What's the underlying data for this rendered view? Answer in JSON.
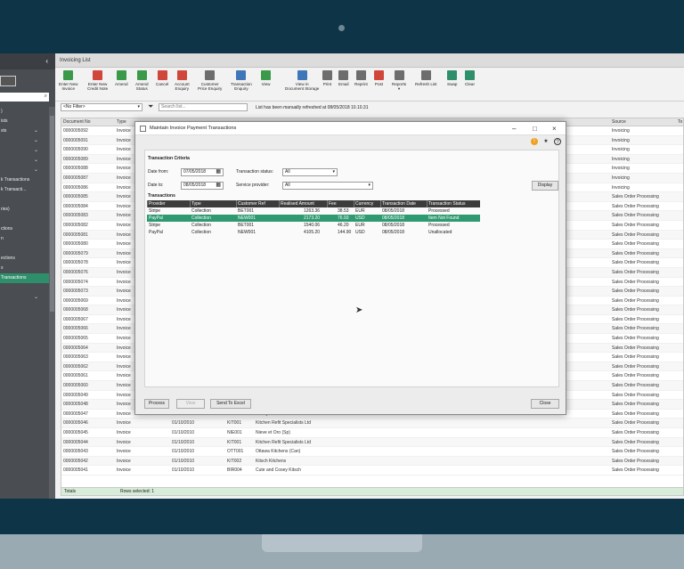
{
  "app": {
    "title": "Invoicing List"
  },
  "nav": {
    "collapse_icon": "‹",
    "items": [
      {
        "label": ")",
        "chev": ""
      },
      {
        "label": "ists",
        "chev": ""
      },
      {
        "label": "sts",
        "chev": "⌄"
      },
      {
        "label": "",
        "chev": "⌄"
      },
      {
        "label": "",
        "chev": "⌄"
      },
      {
        "label": "",
        "chev": "⌄"
      },
      {
        "label": "",
        "chev": "⌄"
      },
      {
        "label": "k Transactions",
        "chev": ""
      },
      {
        "label": "k Transacti...",
        "chev": ""
      },
      {
        "label": "",
        "chev": ""
      },
      {
        "label": "ries)",
        "chev": ""
      },
      {
        "label": "",
        "chev": ""
      },
      {
        "label": "ctions",
        "chev": ""
      },
      {
        "label": "n",
        "chev": ""
      },
      {
        "label": "",
        "chev": ""
      },
      {
        "label": "ections",
        "chev": ""
      },
      {
        "label": "s",
        "chev": ""
      },
      {
        "label": "Transactions",
        "chev": ""
      },
      {
        "label": "",
        "chev": ""
      },
      {
        "label": "",
        "chev": "⌄"
      }
    ]
  },
  "toolbar": {
    "buttons": [
      {
        "l1": "Enter New",
        "l2": "Invoice",
        "color": "green"
      },
      {
        "l1": "Enter New",
        "l2": "Credit Note",
        "color": "red"
      },
      {
        "l1": "Amend",
        "l2": "",
        "color": "green"
      },
      {
        "l1": "Amend",
        "l2": "Status",
        "color": "green"
      },
      {
        "l1": "Cancel",
        "l2": "",
        "color": "red"
      },
      {
        "l1": "Account",
        "l2": "Enquiry",
        "color": "red"
      },
      {
        "l1": "Customer",
        "l2": "Price Enquiry",
        "color": "gray"
      },
      {
        "l1": "Transaction",
        "l2": "Enquiry",
        "color": "blue"
      },
      {
        "l1": "View",
        "l2": "",
        "color": "green"
      },
      {
        "l1": "View in",
        "l2": "Document Storage",
        "color": "blue"
      },
      {
        "l1": "Print",
        "l2": "",
        "color": "gray"
      },
      {
        "l1": "Email",
        "l2": "",
        "color": "gray"
      },
      {
        "l1": "Reprint",
        "l2": "",
        "color": "gray"
      },
      {
        "l1": "Post",
        "l2": "",
        "color": "red"
      },
      {
        "l1": "Reports",
        "l2": "▾",
        "color": "gray"
      },
      {
        "l1": "Refresh List",
        "l2": "",
        "color": "gray"
      },
      {
        "l1": "Swap",
        "l2": "",
        "color": "teal"
      },
      {
        "l1": "Clear",
        "l2": "",
        "color": "teal"
      }
    ]
  },
  "filter": {
    "selected": "<No Filter>",
    "search_placeholder": "Search list...",
    "refresh_msg": "List has been manually refreshed at 08/05/2018 10.10.31"
  },
  "grid": {
    "headers": {
      "doc": "Document No",
      "type": "Type",
      "source": "Source",
      "extra": "To"
    },
    "rows": [
      {
        "doc": "0000005092",
        "type": "Invoice",
        "date": "",
        "ref": "",
        "name": "",
        "source": "Invoicing"
      },
      {
        "doc": "0000005091",
        "type": "Invoice",
        "date": "",
        "ref": "",
        "name": "",
        "source": "Invoicing"
      },
      {
        "doc": "0000005090",
        "type": "Invoice",
        "date": "",
        "ref": "",
        "name": "",
        "source": "Invoicing"
      },
      {
        "doc": "0000005089",
        "type": "Invoice",
        "date": "",
        "ref": "",
        "name": "",
        "source": "Invoicing"
      },
      {
        "doc": "0000005088",
        "type": "Invoice",
        "date": "",
        "ref": "",
        "name": "",
        "source": "Invoicing"
      },
      {
        "doc": "0000005087",
        "type": "Invoice",
        "date": "",
        "ref": "",
        "name": "",
        "source": "Invoicing"
      },
      {
        "doc": "0000005086",
        "type": "Invoice",
        "date": "",
        "ref": "",
        "name": "",
        "source": "Invoicing"
      },
      {
        "doc": "0000005085",
        "type": "Invoice",
        "date": "",
        "ref": "",
        "name": "",
        "source": "Sales Order Processing"
      },
      {
        "doc": "0000005084",
        "type": "Invoice",
        "date": "",
        "ref": "",
        "name": "",
        "source": "Sales Order Processing"
      },
      {
        "doc": "0000005083",
        "type": "Invoice",
        "date": "",
        "ref": "",
        "name": "",
        "source": "Sales Order Processing"
      },
      {
        "doc": "0000005082",
        "type": "Invoice",
        "date": "",
        "ref": "",
        "name": "",
        "source": "Sales Order Processing"
      },
      {
        "doc": "0000005081",
        "type": "Invoice",
        "date": "",
        "ref": "",
        "name": "",
        "source": "Sales Order Processing"
      },
      {
        "doc": "0000005080",
        "type": "Invoice",
        "date": "",
        "ref": "",
        "name": "",
        "source": "Sales Order Processing"
      },
      {
        "doc": "0000005079",
        "type": "Invoice",
        "date": "",
        "ref": "",
        "name": "",
        "source": "Sales Order Processing"
      },
      {
        "doc": "0000005078",
        "type": "Invoice",
        "date": "",
        "ref": "",
        "name": "",
        "source": "Sales Order Processing"
      },
      {
        "doc": "0000005076",
        "type": "Invoice",
        "date": "",
        "ref": "",
        "name": "",
        "source": "Sales Order Processing"
      },
      {
        "doc": "0000005074",
        "type": "Invoice",
        "date": "",
        "ref": "",
        "name": "",
        "source": "Sales Order Processing"
      },
      {
        "doc": "0000005073",
        "type": "Invoice",
        "date": "",
        "ref": "",
        "name": "",
        "source": "Sales Order Processing"
      },
      {
        "doc": "0000005069",
        "type": "Invoice",
        "date": "",
        "ref": "",
        "name": "",
        "source": "Sales Order Processing"
      },
      {
        "doc": "0000005068",
        "type": "Invoice",
        "date": "",
        "ref": "",
        "name": "",
        "source": "Sales Order Processing"
      },
      {
        "doc": "0000005067",
        "type": "Invoice",
        "date": "",
        "ref": "",
        "name": "",
        "source": "Sales Order Processing"
      },
      {
        "doc": "0000005066",
        "type": "Invoice",
        "date": "",
        "ref": "",
        "name": "",
        "source": "Sales Order Processing"
      },
      {
        "doc": "0000005065",
        "type": "Invoice",
        "date": "",
        "ref": "",
        "name": "",
        "source": "Sales Order Processing"
      },
      {
        "doc": "0000005064",
        "type": "Invoice",
        "date": "",
        "ref": "",
        "name": "",
        "source": "Sales Order Processing"
      },
      {
        "doc": "0000005063",
        "type": "Invoice",
        "date": "",
        "ref": "",
        "name": "",
        "source": "Sales Order Processing"
      },
      {
        "doc": "0000005062",
        "type": "Invoice",
        "date": "",
        "ref": "",
        "name": "",
        "source": "Sales Order Processing"
      },
      {
        "doc": "0000005061",
        "type": "Invoice",
        "date": "",
        "ref": "",
        "name": "",
        "source": "Sales Order Processing"
      },
      {
        "doc": "0000005060",
        "type": "Invoice",
        "date": "",
        "ref": "",
        "name": "",
        "source": "Sales Order Processing"
      },
      {
        "doc": "0000005049",
        "type": "Invoice",
        "date": "",
        "ref": "",
        "name": "",
        "source": "Sales Order Processing"
      },
      {
        "doc": "0000005048",
        "type": "Invoice",
        "date": "",
        "ref": "",
        "name": "",
        "source": "Sales Order Processing"
      },
      {
        "doc": "0000005047",
        "type": "Invoice",
        "date": "01/10/2010",
        "ref": "AB001",
        "name": "Abbey Retail Ltd",
        "source": "Sales Order Processing"
      },
      {
        "doc": "0000005046",
        "type": "Invoice",
        "date": "01/10/2010",
        "ref": "KIT001",
        "name": "Kitchen Refit Specialists Ltd",
        "source": "Sales Order Processing"
      },
      {
        "doc": "0000005045",
        "type": "Invoice",
        "date": "01/10/2010",
        "ref": "NIE001",
        "name": "Nieve et Oro (Sp)",
        "source": "Sales Order Processing"
      },
      {
        "doc": "0000005044",
        "type": "Invoice",
        "date": "01/10/2010",
        "ref": "KIT001",
        "name": "Kitchen Refit Specialists Ltd",
        "source": "Sales Order Processing"
      },
      {
        "doc": "0000005043",
        "type": "Invoice",
        "date": "01/10/2010",
        "ref": "OTT001",
        "name": "Ottawa Kitchens (Can)",
        "source": "Sales Order Processing"
      },
      {
        "doc": "0000005042",
        "type": "Invoice",
        "date": "01/10/2010",
        "ref": "KIT002",
        "name": "Kitsch Kitchens",
        "source": "Sales Order Processing"
      },
      {
        "doc": "0000005041",
        "type": "Invoice",
        "date": "01/10/2010",
        "ref": "BIR004",
        "name": "Cute and Cosey Kitsch",
        "source": "Sales Order Processing"
      }
    ],
    "footer": {
      "totals": "Totals",
      "rows_selected": "Rows selected: 1"
    }
  },
  "modal": {
    "title": "Maintain Invoice Payment Transactions",
    "criteria_title": "Transaction Criteria",
    "date_from_label": "Date from:",
    "date_from_value": "07/05/2018",
    "date_to_label": "Date to:",
    "date_to_value": "08/05/2018",
    "status_label": "Transaction status:",
    "status_value": "All",
    "provider_label": "Service provider:",
    "provider_value": "All",
    "display_btn": "Display",
    "transactions_title": "Transactions",
    "columns": [
      "Provider",
      "Type",
      "Customer Ref",
      "Realised Amount",
      "Fee",
      "Currency",
      "Transaction Date",
      "Transaction Status"
    ],
    "rows": [
      {
        "provider": "Stripe",
        "type": "Collection",
        "ref": "BET001",
        "amount": "1263.36",
        "fee": "38.53",
        "currency": "EUR",
        "date": "08/05/2018",
        "status": "Processed",
        "selected": false
      },
      {
        "provider": "PayPal",
        "type": "Collection",
        "ref": "NEW001",
        "amount": "2173.20",
        "fee": "76.93",
        "currency": "USD",
        "date": "08/05/2018",
        "status": "Item Not Found",
        "selected": true
      },
      {
        "provider": "Stripe",
        "type": "Collection",
        "ref": "BET001",
        "amount": "1540.06",
        "fee": "46.20",
        "currency": "EUR",
        "date": "08/05/2018",
        "status": "Processed",
        "selected": false
      },
      {
        "provider": "PayPal",
        "type": "Collection",
        "ref": "NEW001",
        "amount": "4105.20",
        "fee": "144.90",
        "currency": "USD",
        "date": "08/05/2018",
        "status": "Unallocated",
        "selected": false
      }
    ],
    "process_btn": "Process",
    "view_btn": "View",
    "excel_btn": "Send To Excel",
    "close_btn": "Close"
  }
}
